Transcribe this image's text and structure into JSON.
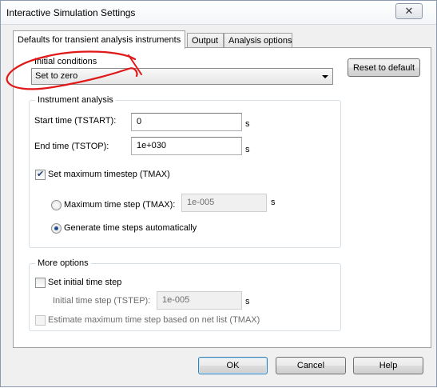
{
  "window": {
    "title": "Interactive Simulation Settings"
  },
  "tabs": [
    {
      "label": "Defaults for transient analysis instruments"
    },
    {
      "label": "Output"
    },
    {
      "label": "Analysis options"
    }
  ],
  "initial_conditions": {
    "group_title": "Initial conditions",
    "selected": "Set to zero"
  },
  "reset_button": "Reset to default",
  "instrument_analysis": {
    "group_title": "Instrument analysis",
    "start_label": "Start time (TSTART):",
    "start_value": "0",
    "start_unit": "s",
    "end_label": "End time (TSTOP):",
    "end_value": "1e+030",
    "end_unit": "s",
    "set_max_timestep_label": "Set maximum timestep (TMAX)",
    "set_max_timestep_checked": true,
    "max_step_label": "Maximum time step (TMAX):",
    "max_step_value": "1e-005",
    "max_step_unit": "s",
    "auto_label": "Generate time steps automatically"
  },
  "more_options": {
    "group_title": "More options",
    "set_initial_label": "Set initial time step",
    "initial_step_label": "Initial time step (TSTEP):",
    "initial_step_value": "1e-005",
    "initial_step_unit": "s",
    "estimate_label": "Estimate maximum time step based on net list (TMAX)"
  },
  "buttons": {
    "ok": "OK",
    "cancel": "Cancel",
    "help": "Help"
  },
  "annotation_color": "#e01818"
}
